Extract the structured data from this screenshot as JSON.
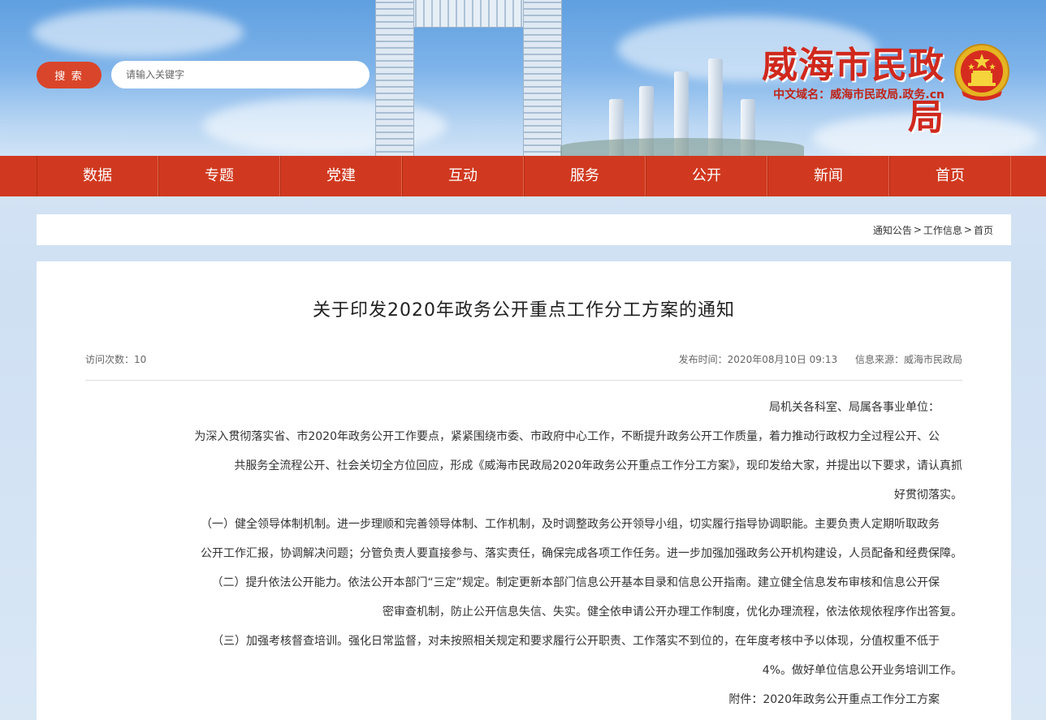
{
  "header": {
    "search_button": "搜 索",
    "search_placeholder": "请输入关键字",
    "site_title": "威海市民政局",
    "domain_line": "中文域名：威海市民政局.政务.cn"
  },
  "nav": {
    "items": [
      "首页",
      "新闻",
      "公开",
      "服务",
      "互动",
      "党建",
      "专题",
      "数据"
    ]
  },
  "breadcrumb": {
    "home": "首页",
    "sep1": ">",
    "section": "工作信息",
    "sep2": ">",
    "current": "通知公告"
  },
  "article": {
    "title": "关于印发2020年政务公开重点工作分工方案的通知",
    "publish_time": "发布时间：2020年08月10日 09:13",
    "source": "信息来源：威海市民政局",
    "views": "访问次数：10",
    "paragraphs": [
      "局机关各科室、局属各事业单位：",
      "为深入贯彻落实省、市2020年政务公开工作要点，紧紧围绕市委、市政府中心工作，不断提升政务公开工作质量，着力推动行政权力全过程公开、公",
      "共服务全流程公开、社会关切全方位回应，形成《威海市民政局2020年政务公开重点工作分工方案》，现印发给大家，并提出以下要求，请认真抓",
      "好贯彻落实。",
      "（一）健全领导体制机制。进一步理顺和完善领导体制、工作机制，及时调整政务公开领导小组，切实履行指导协调职能。主要负责人定期听取政务",
      "公开工作汇报，协调解决问题；分管负责人要直接参与、落实责任，确保完成各项工作任务。进一步加强加强政务公开机构建设，人员配备和经费保障。",
      "（二）提升依法公开能力。依法公开本部门“三定”规定。制定更新本部门信息公开基本目录和信息公开指南。建立健全信息发布审核和信息公开保",
      "密审查机制，防止公开信息失信、失实。健全依申请公开办理工作制度，优化办理流程，依法依规依程序作出答复。",
      "（三）加强考核督查培训。强化日常监督，对未按照相关规定和要求履行公开职责、工作落实不到位的，在年度考核中予以体现，分值权重不低于",
      "4%。做好单位信息公开业务培训工作。",
      "附件：2020年政务公开重点工作分工方案"
    ]
  }
}
